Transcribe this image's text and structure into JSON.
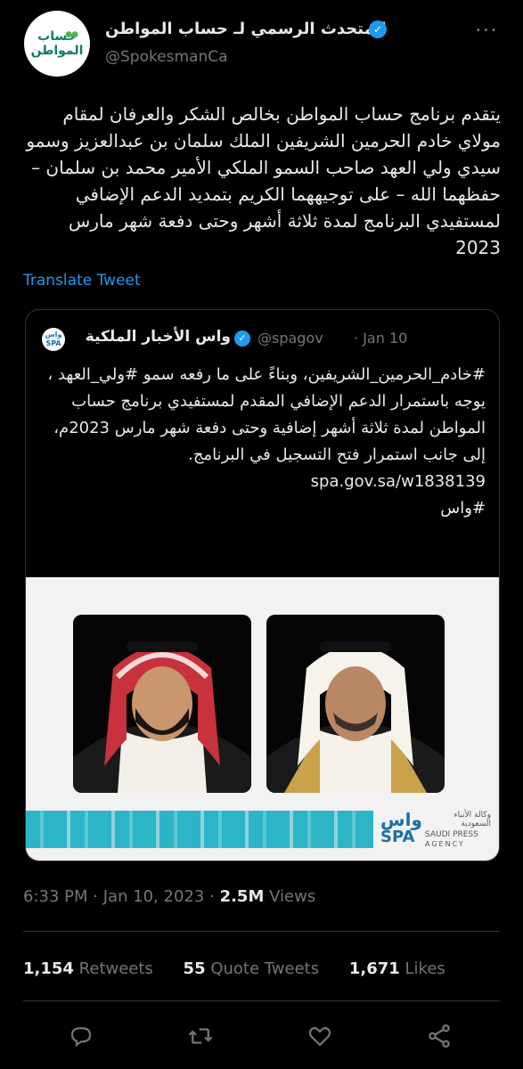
{
  "header": {
    "avatar_line1": "حساب",
    "avatar_line2": "المواطن",
    "display_name": "المتحدث الرسمي لـ حساب المواطن",
    "verified_icon": "verified-badge-icon",
    "handle": "@SpokesmanCa",
    "more_icon": "more-icon"
  },
  "tweet": {
    "text": "يتقدم برنامج حساب المواطن بخالص الشكر والعرفان لمقام مولاي خادم الحرمين الشريفين الملك سلمان بن عبدالعزيز وسمو سيدي ولي العهد صاحب السمو الملكي الأمير محمد بن سلمان – حفظهما الله – على توجيههما الكريم بتمديد الدعم الإضافي لمستفيدي البرنامج لمدة ثلاثة أشهر وحتى دفعة شهر مارس 2023",
    "translate_label": "Translate Tweet"
  },
  "quote": {
    "avatar_text": "واس SPA",
    "name": "واس الأخبار الملكية",
    "handle": "@spagov",
    "separator": "·",
    "date": "Jan 10",
    "text": "#خادم_الحرمين_الشريفين، وبناءً على ما رفعه سمو #ولي_العهد ، يوجه باستمرار الدعم الإضافي المقدم لمستفيدي برنامج حساب المواطن لمدة ثلاثة أشهر إضافية وحتى دفعة شهر مارس 2023م، إلى جانب استمرار فتح التسجيل في البرنامج.",
    "link": "spa.gov.sa/w1838139",
    "hashtag": "#واس",
    "image": {
      "logo_mark": "واس",
      "logo_mark2": "SPA",
      "logo_ar": "وكالة الأنباء السعودية",
      "logo_en1": "SAUDI PRESS",
      "logo_en2": "AGENCY"
    }
  },
  "meta": {
    "time": "6:33 PM",
    "separator": "·",
    "date": "Jan 10, 2023",
    "views_count": "2.5M",
    "views_label": "Views"
  },
  "stats": {
    "retweets_count": "1,154",
    "retweets_label": "Retweets",
    "quotes_count": "55",
    "quotes_label": "Quote Tweets",
    "likes_count": "1,671",
    "likes_label": "Likes"
  },
  "actions": [
    "reply-icon",
    "retweet-icon",
    "like-icon",
    "share-icon"
  ],
  "colors": {
    "accent": "#1d9bf0",
    "muted": "#71767b",
    "text": "#e7e9ea",
    "border": "#2f3336"
  }
}
